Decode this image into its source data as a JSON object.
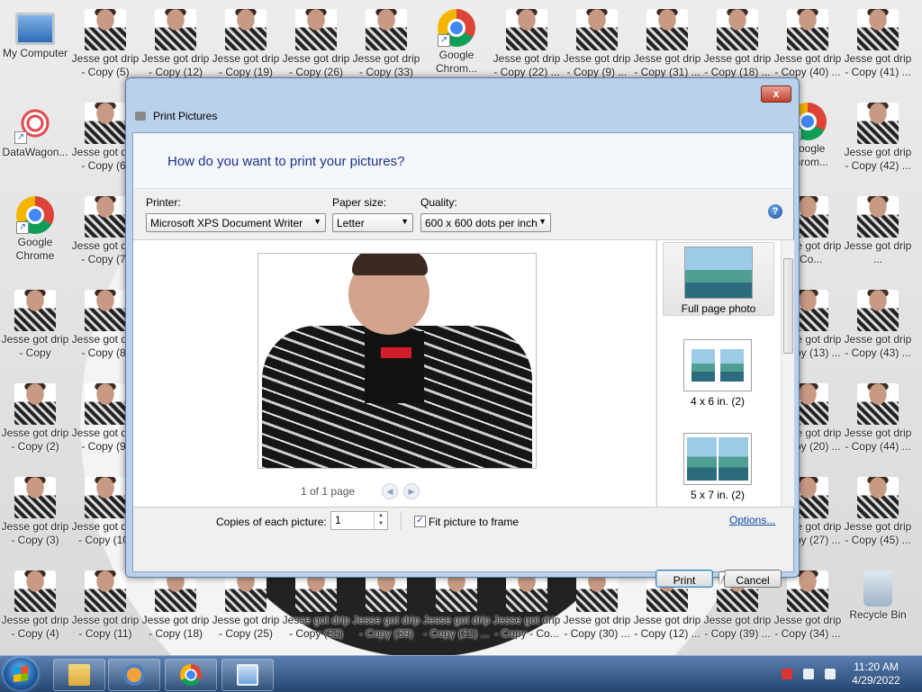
{
  "desktop": {
    "icons": [
      {
        "label": "My Computer",
        "type": "computer"
      },
      {
        "label": "Jesse got drip - Copy (5)",
        "type": "jesse"
      },
      {
        "label": "Jesse got drip - Copy (12)",
        "type": "jesse"
      },
      {
        "label": "Jesse got drip - Copy (19)",
        "type": "jesse"
      },
      {
        "label": "Jesse got drip - Copy (26)",
        "type": "jesse"
      },
      {
        "label": "Jesse got drip - Copy (33)",
        "type": "jesse"
      },
      {
        "label": "Google Chrom...",
        "type": "chrome"
      },
      {
        "label": "Jesse got drip - Copy (22) ...",
        "type": "jesse"
      },
      {
        "label": "Jesse got drip - Copy (9) ...",
        "type": "jesse"
      },
      {
        "label": "Jesse got drip - Copy (31) ...",
        "type": "jesse"
      },
      {
        "label": "Jesse got drip - Copy (18) ...",
        "type": "jesse"
      },
      {
        "label": "Jesse got drip - Copy (40) ...",
        "type": "jesse"
      },
      {
        "label": "Jesse got drip - Copy (41) ...",
        "type": "jesse"
      },
      {
        "label": "DataWagon...",
        "type": "datawagon"
      },
      {
        "label": "Jesse got drip - Copy (6)",
        "type": "jesse"
      },
      {
        "label": "Google Chrom...",
        "type": "chrome"
      },
      {
        "label": "Jesse got drip - Copy (42) ...",
        "type": "jesse"
      },
      {
        "label": "Google Chrome",
        "type": "chrome"
      },
      {
        "label": "Jesse got drip - Copy (7)",
        "type": "jesse"
      },
      {
        "label": "Jesse got drip - Co...",
        "type": "jesse"
      },
      {
        "label": "Jesse got drip ...",
        "type": "jesse"
      },
      {
        "label": "Jesse got drip - Copy",
        "type": "jesse"
      },
      {
        "label": "Jesse got drip - Copy (8)",
        "type": "jesse"
      },
      {
        "label": "Jesse got drip - Copy (13) ...",
        "type": "jesse"
      },
      {
        "label": "Jesse got drip - Copy (43) ...",
        "type": "jesse"
      },
      {
        "label": "Jesse got drip - Copy (2)",
        "type": "jesse"
      },
      {
        "label": "Jesse got drip - Copy (9)",
        "type": "jesse"
      },
      {
        "label": "Jesse got drip - Copy (20) ...",
        "type": "jesse"
      },
      {
        "label": "Jesse got drip - Copy (44) ...",
        "type": "jesse"
      },
      {
        "label": "Jesse got drip - Copy (3)",
        "type": "jesse"
      },
      {
        "label": "Jesse got drip - Copy (10)",
        "type": "jesse"
      },
      {
        "label": "Jesse got drip - Copy (27) ...",
        "type": "jesse"
      },
      {
        "label": "Jesse got drip - Copy (45) ...",
        "type": "jesse"
      },
      {
        "label": "Jesse got drip - Copy (4)",
        "type": "jesse"
      },
      {
        "label": "Jesse got drip - Copy (11)",
        "type": "jesse"
      },
      {
        "label": "Jesse got drip - Copy (18)",
        "type": "jesse"
      },
      {
        "label": "Jesse got drip - Copy (25)",
        "type": "jesse"
      },
      {
        "label": "Jesse got drip - Copy (32)",
        "type": "jesse"
      },
      {
        "label": "Jesse got drip - Copy (39)",
        "type": "jesse"
      },
      {
        "label": "Jesse got drip - Copy (21) ...",
        "type": "jesse"
      },
      {
        "label": "Jesse got drip - Copy - Co...",
        "type": "jesse"
      },
      {
        "label": "Jesse got drip - Copy (30) ...",
        "type": "jesse"
      },
      {
        "label": "Jesse got drip - Copy (12) ...",
        "type": "jesse"
      },
      {
        "label": "Jesse got drip - Copy (39) ...",
        "type": "jesse"
      },
      {
        "label": "Jesse got drip - Copy (34) ...",
        "type": "jesse"
      },
      {
        "label": "Recycle Bin",
        "type": "recycle"
      }
    ]
  },
  "dialog": {
    "title": "Print Pictures",
    "close_label": "x",
    "instruction": "How do you want to print your pictures?",
    "printer": {
      "label": "Printer:",
      "value": "Microsoft XPS Document Writer"
    },
    "paper_size": {
      "label": "Paper size:",
      "value": "Letter"
    },
    "quality": {
      "label": "Quality:",
      "value": "600 x 600 dots per inch"
    },
    "help_label": "?",
    "preview": {
      "page_text": "1 of 1 page",
      "prev_label": "◀",
      "next_label": "▶"
    },
    "layouts": [
      {
        "label": "Full page photo",
        "selected": true
      },
      {
        "label": "4 x 6 in. (2)",
        "selected": false
      },
      {
        "label": "5 x 7 in. (2)",
        "selected": false
      }
    ],
    "copies": {
      "label": "Copies of each picture:",
      "value": "1"
    },
    "fit": {
      "label": "Fit picture to frame",
      "checked": true
    },
    "options_link": "Options...",
    "print_button": "Print",
    "cancel_button": "Cancel"
  },
  "taskbar": {
    "time": "11:20 AM",
    "date": "4/29/2022"
  },
  "colors": {
    "dialog_frame": "#b9d1ea",
    "instruction_text": "#1e3287",
    "link": "#0a4aa8",
    "taskbar": "#24456f"
  }
}
